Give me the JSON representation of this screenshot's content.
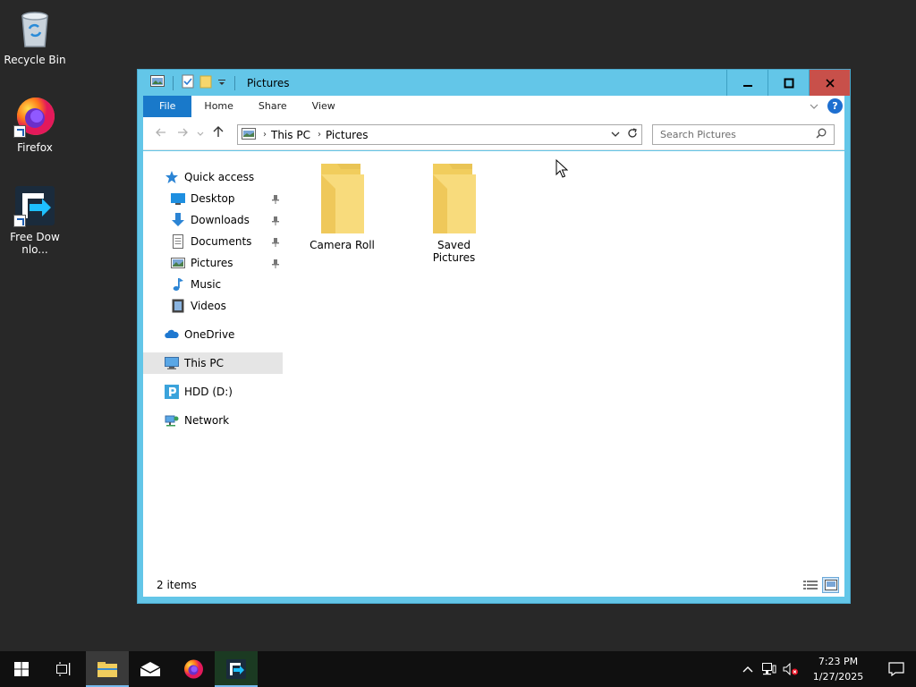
{
  "desktop": {
    "icons": [
      {
        "label": "Recycle Bin",
        "icon": "recycle-bin-icon"
      },
      {
        "label": "Firefox",
        "icon": "firefox-icon"
      },
      {
        "label": "Free Downlo...",
        "icon": "free-download-manager-icon"
      }
    ]
  },
  "window": {
    "title": "Pictures",
    "ribbon_tabs": [
      {
        "label": "File"
      },
      {
        "label": "Home"
      },
      {
        "label": "Share"
      },
      {
        "label": "View"
      }
    ],
    "address": {
      "crumbs": [
        "This PC",
        "Pictures"
      ]
    },
    "search": {
      "placeholder": "Search Pictures"
    },
    "nav": {
      "quick_access": "Quick access",
      "items": [
        {
          "label": "Desktop",
          "pinned": true
        },
        {
          "label": "Downloads",
          "pinned": true
        },
        {
          "label": "Documents",
          "pinned": true
        },
        {
          "label": "Pictures",
          "pinned": true
        },
        {
          "label": "Music",
          "pinned": false
        },
        {
          "label": "Videos",
          "pinned": false
        }
      ],
      "onedrive": "OneDrive",
      "this_pc": "This PC",
      "hdd": "HDD (D:)",
      "network": "Network"
    },
    "folders": [
      {
        "label": "Camera Roll"
      },
      {
        "label": "Saved Pictures"
      }
    ],
    "status": {
      "items": "2 items"
    }
  },
  "taskbar": {
    "clock_time": "7:23 PM",
    "clock_date": "1/27/2025"
  },
  "colors": {
    "title_bar": "#63c6e8",
    "file_tab": "#1979ca",
    "close_button": "#c8504a",
    "taskbar": "#101010",
    "folder": "#f6d66c"
  }
}
